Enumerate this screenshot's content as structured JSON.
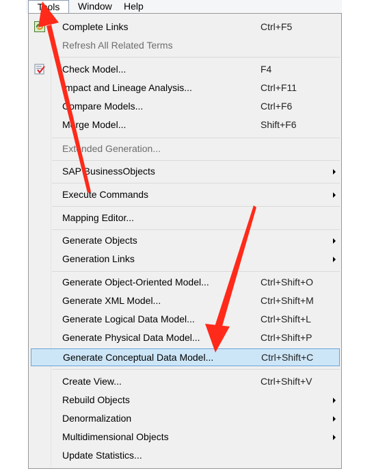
{
  "menubar": {
    "tools": "Tools",
    "window": "Window",
    "help": "Help"
  },
  "menu": {
    "complete_links": {
      "label": "Complete Links",
      "shortcut": "Ctrl+F5"
    },
    "refresh_all": {
      "label": "Refresh All Related Terms"
    },
    "check_model": {
      "label": "Check Model...",
      "shortcut": "F4"
    },
    "impact_lineage": {
      "label": "Impact and Lineage Analysis...",
      "shortcut": "Ctrl+F11"
    },
    "compare_models": {
      "label": "Compare Models...",
      "shortcut": "Ctrl+F6"
    },
    "merge_model": {
      "label": "Merge Model...",
      "shortcut": "Shift+F6"
    },
    "extended_generation": {
      "label": "Extended Generation..."
    },
    "sap_bo": {
      "label": "SAP BusinessObjects"
    },
    "execute_commands": {
      "label": "Execute Commands"
    },
    "mapping_editor": {
      "label": "Mapping Editor..."
    },
    "generate_objects": {
      "label": "Generate Objects"
    },
    "generation_links": {
      "label": "Generation Links"
    },
    "gen_oom": {
      "label": "Generate Object-Oriented Model...",
      "shortcut": "Ctrl+Shift+O"
    },
    "gen_xml": {
      "label": "Generate XML Model...",
      "shortcut": "Ctrl+Shift+M"
    },
    "gen_ldm": {
      "label": "Generate Logical Data Model...",
      "shortcut": "Ctrl+Shift+L"
    },
    "gen_pdm": {
      "label": "Generate Physical Data Model...",
      "shortcut": "Ctrl+Shift+P"
    },
    "gen_cdm": {
      "label": "Generate Conceptual Data Model...",
      "shortcut": "Ctrl+Shift+C"
    },
    "create_view": {
      "label": "Create View...",
      "shortcut": "Ctrl+Shift+V"
    },
    "rebuild_objects": {
      "label": "Rebuild Objects"
    },
    "denormalization": {
      "label": "Denormalization"
    },
    "multidimensional": {
      "label": "Multidimensional Objects"
    },
    "update_statistics": {
      "label": "Update Statistics..."
    }
  },
  "colors": {
    "highlight": "#cde6f7",
    "arrow": "#ff2a1a"
  }
}
